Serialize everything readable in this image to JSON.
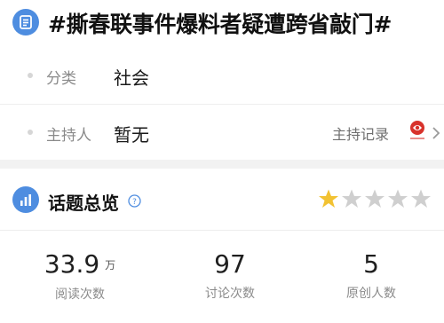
{
  "topic": {
    "title": "#撕春联事件爆料者疑遭跨省敲门#",
    "icon": "document-list-icon"
  },
  "meta": {
    "category_label": "分类",
    "category_value": "社会",
    "host_label": "主持人",
    "host_value": "暂无",
    "host_record_link": "主持记录",
    "host_logo_icon": "media-logo-icon"
  },
  "overview": {
    "title": "话题总览",
    "icon": "bar-chart-icon",
    "help_icon": "question-circle-icon",
    "rating": {
      "filled": 1,
      "total": 5,
      "filled_color": "#f2c232",
      "empty_color": "#cfcfcf"
    },
    "stats": [
      {
        "value": "33.9",
        "unit": "万",
        "label": "阅读次数"
      },
      {
        "value": "97",
        "unit": "",
        "label": "讨论次数"
      },
      {
        "value": "5",
        "unit": "",
        "label": "原创人数"
      }
    ]
  },
  "colors": {
    "accent_blue": "#4e8de0",
    "logo_red": "#d8322b"
  }
}
